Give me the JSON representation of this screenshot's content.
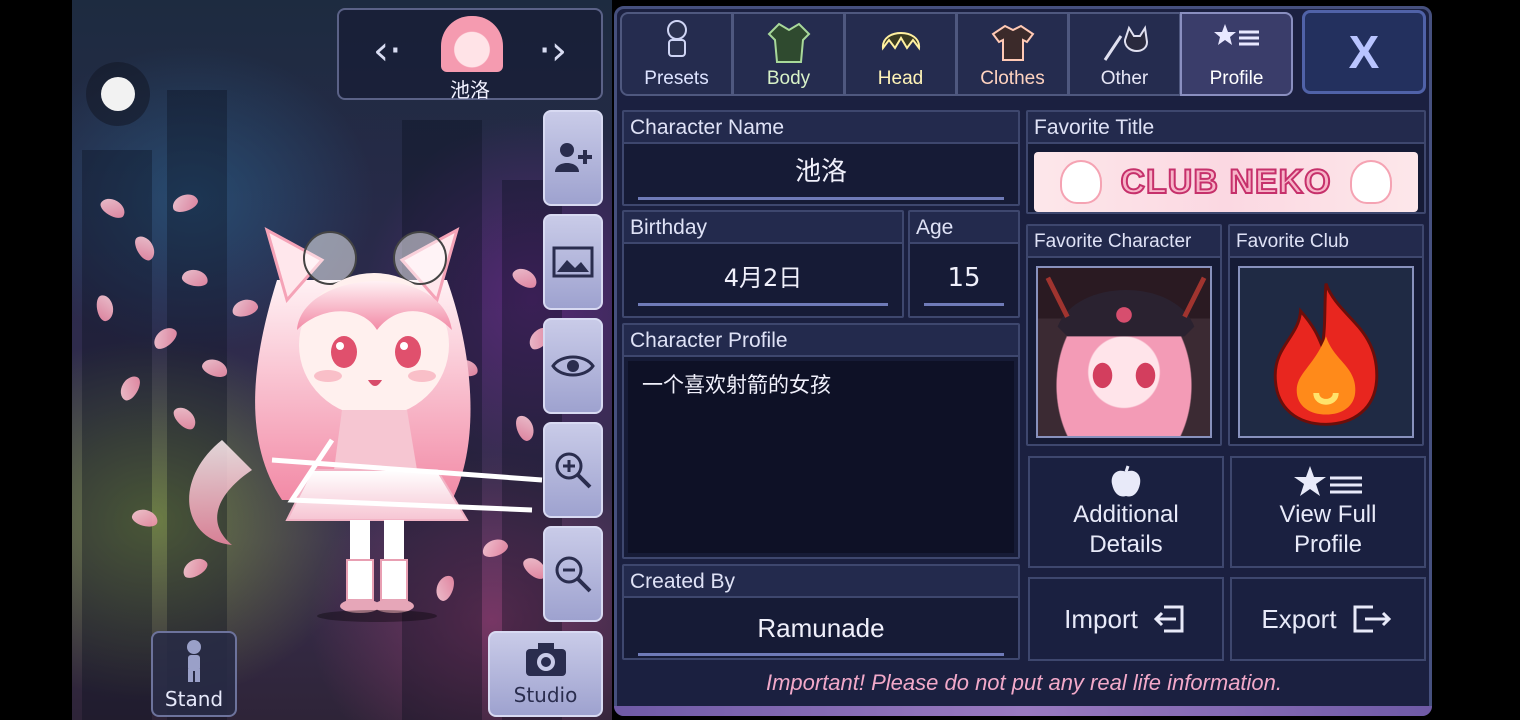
{
  "character_nav": {
    "name": "池洛"
  },
  "side_buttons": [
    "add-character",
    "background",
    "view",
    "zoom-in",
    "zoom-out"
  ],
  "bottom_left": {
    "stand_label": "Stand",
    "studio_label": "Studio"
  },
  "tabs": [
    {
      "label": "Presets",
      "icon": "person-silhouette-icon"
    },
    {
      "label": "Body",
      "icon": "jacket-icon"
    },
    {
      "label": "Head",
      "icon": "hair-icon"
    },
    {
      "label": "Clothes",
      "icon": "shirt-icon"
    },
    {
      "label": "Other",
      "icon": "sword-cat-icon"
    },
    {
      "label": "Profile",
      "icon": "star-list-icon",
      "active": true
    }
  ],
  "close_label": "X",
  "profile": {
    "character_name_label": "Character Name",
    "character_name": "池洛",
    "birthday_label": "Birthday",
    "birthday": "4月2日",
    "age_label": "Age",
    "age": "15",
    "character_profile_label": "Character Profile",
    "character_profile": "一个喜欢射箭的女孩",
    "created_by_label": "Created By",
    "created_by": "Ramunade",
    "favorite_title_label": "Favorite Title",
    "favorite_title": "CLUB NEKO",
    "favorite_character_label": "Favorite Character",
    "favorite_club_label": "Favorite Club",
    "additional_details_label": "Additional Details",
    "view_full_profile_label": "View Full Profile",
    "import_label": "Import",
    "export_label": "Export",
    "warning": "Important! Please do not put any real life information."
  },
  "colors": {
    "panel_bg": "#1b2040",
    "accent_pink": "#f2a9c9",
    "tab_active": "#3a3d6a"
  }
}
